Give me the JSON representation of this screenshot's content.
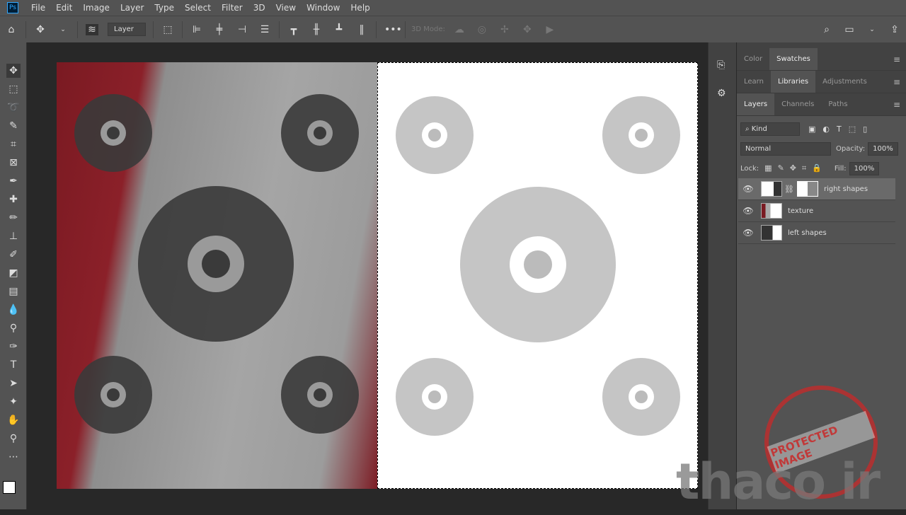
{
  "app": {
    "logo": "Ps"
  },
  "menu": [
    "File",
    "Edit",
    "Image",
    "Layer",
    "Type",
    "Select",
    "Filter",
    "3D",
    "View",
    "Window",
    "Help"
  ],
  "options": {
    "auto_select": "Layer",
    "mode_3d": "3D Mode:"
  },
  "panels": {
    "row1": {
      "tabs": [
        "Color",
        "Swatches"
      ],
      "active": "Swatches"
    },
    "row2": {
      "tabs": [
        "Learn",
        "Libraries",
        "Adjustments"
      ],
      "active": "Libraries"
    },
    "row3": {
      "tabs": [
        "Layers",
        "Channels",
        "Paths"
      ],
      "active": "Layers"
    }
  },
  "layers_panel": {
    "filter_kind": "Kind",
    "blend_mode": "Normal",
    "opacity_label": "Opacity:",
    "opacity": "100%",
    "lock_label": "Lock:",
    "fill_label": "Fill:",
    "fill": "100%",
    "layers": [
      {
        "name": "right shapes",
        "visible": true,
        "selected": true
      },
      {
        "name": "texture",
        "visible": true,
        "selected": false
      },
      {
        "name": "left shapes",
        "visible": true,
        "selected": false
      }
    ]
  },
  "watermark": {
    "stamp": "PROTECTED IMAGE",
    "logo": "thaco ir"
  }
}
